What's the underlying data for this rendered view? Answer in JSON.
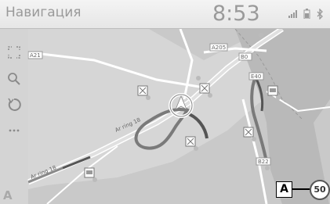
{
  "header": {
    "title": "Навигация",
    "time": "8:53",
    "icons": [
      "signal-icon",
      "battery-icon",
      "bluetooth-icon"
    ]
  },
  "sidebar": {
    "items": [
      {
        "name": "fullscreen-button",
        "icon": "expand-icon"
      },
      {
        "name": "search-button",
        "icon": "search-icon"
      },
      {
        "name": "back-button",
        "icon": "reroute-icon"
      },
      {
        "name": "more-button",
        "icon": "more-icon"
      }
    ]
  },
  "map": {
    "road_labels": [
      "A21",
      "A205",
      "B0",
      "E40",
      "B22",
      "Ar ring 18",
      "Ar ring 18"
    ],
    "route_color": "#7a7a7a",
    "traffic_color": "#555555"
  },
  "overlay": {
    "callout": "A",
    "speed_limit": "50",
    "compass": "A"
  }
}
